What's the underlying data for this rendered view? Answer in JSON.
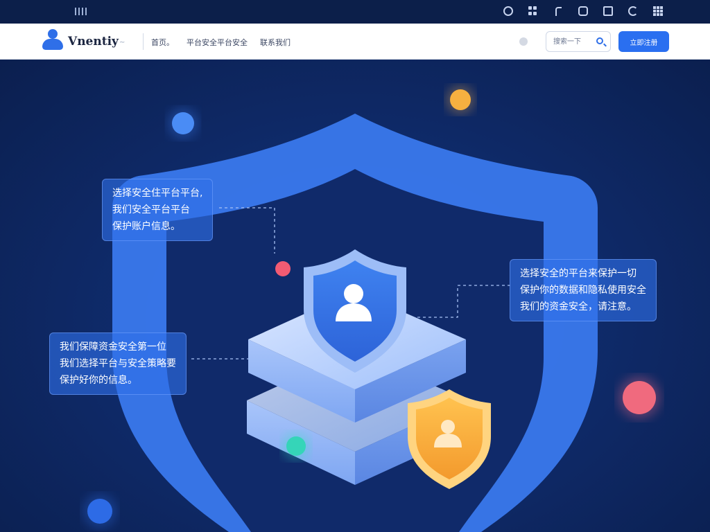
{
  "status_bar": {
    "icons": [
      "circle-icon",
      "grid-icon",
      "hook-icon",
      "message-icon",
      "document-icon",
      "pie-icon",
      "apps-icon"
    ]
  },
  "navbar": {
    "brand": "Vnentiy",
    "brand_tail": "~",
    "links": [
      "首页。",
      "平台安全平台安全",
      "联系我们"
    ],
    "search_placeholder": "搜索一下",
    "cta_label": "立即注册"
  },
  "hero": {
    "callout_left_top": [
      "选择安全住平台平台,",
      "我们安全平台平台",
      "保护账户信息。"
    ],
    "callout_right": [
      "选择安全的平台来保护一切",
      "保护你的数据和隐私使用安全",
      "我们的资金安全，请注意。"
    ],
    "callout_left_bottom": [
      "我们保障资金安全第一位",
      "我们选择平台与安全策略要",
      "保护好你的信息。"
    ]
  },
  "colors": {
    "accent": "#2f6fe8",
    "background": "#0b1f4f",
    "shield_blue": "#3a78ec",
    "shield_orange": "#f5a93a"
  }
}
